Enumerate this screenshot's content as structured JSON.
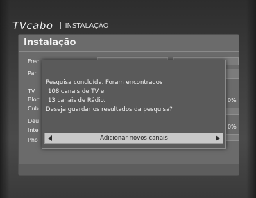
{
  "header": {
    "brand": "TVcabo",
    "breadcrumb": "INSTALAÇÃO"
  },
  "page": {
    "title": "Instalação",
    "rows": [
      {
        "label": "Frec"
      },
      {
        "label": "Par"
      },
      {
        "label": "TV"
      },
      {
        "label": "Bloc",
        "value": "0%"
      },
      {
        "label": "Cub"
      },
      {
        "label": "Deu"
      },
      {
        "label": "Inte",
        "value": "0%"
      },
      {
        "label": "Pho"
      }
    ]
  },
  "dialog": {
    "lines": [
      "Pesquisa concluída. Foram encontrados",
      "108 canais de TV e",
      "13 canais de Rádio.",
      "Deseja guardar os resultados da pesquisa?"
    ],
    "button_label": "Adicionar novos canais"
  },
  "colors": {
    "background": "#3a3a3a",
    "panel": "#6b6b6b",
    "dialog": "#5a5a5a",
    "button": "#c8c8c8"
  }
}
